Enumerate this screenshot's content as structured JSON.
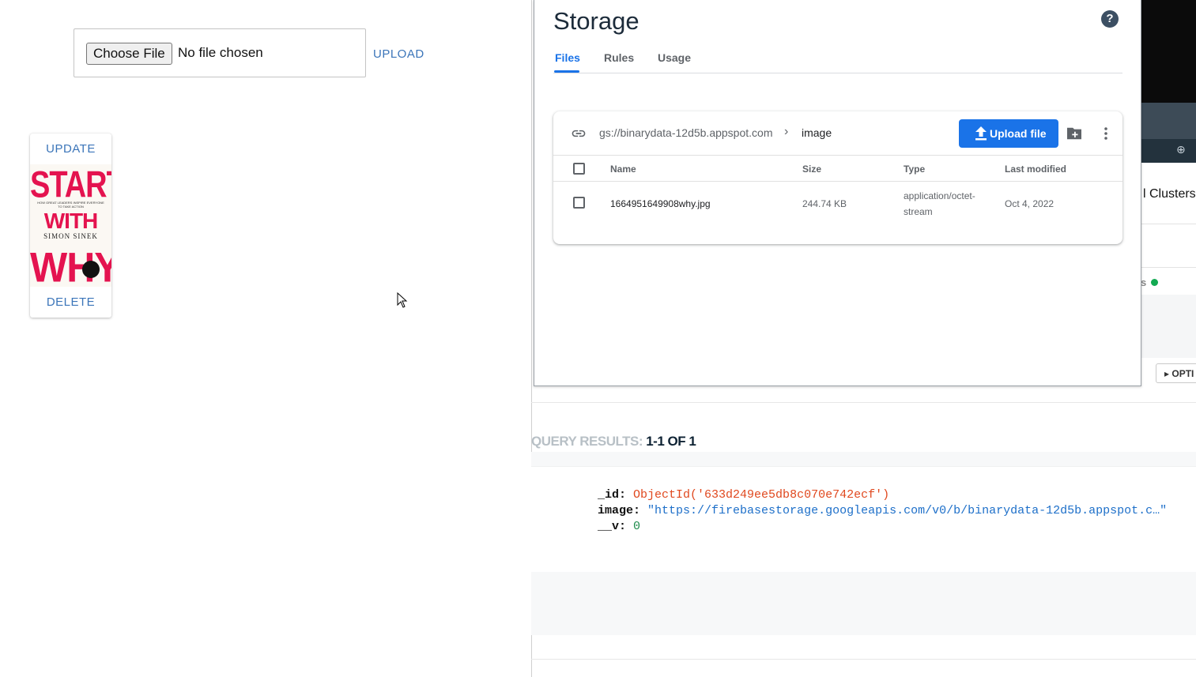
{
  "left_app": {
    "choose_file_label": "Choose File",
    "no_file_text": "No file chosen",
    "upload_label": "UPLOAD",
    "card": {
      "update_label": "UPDATE",
      "delete_label": "DELETE",
      "cover": {
        "line1": "START",
        "line2": "WITH",
        "line3": "WHY",
        "subtitle": "HOW GREAT LEADERS INSPIRE EVERYONE TO TAKE ACTION",
        "author": "SIMON SINEK"
      }
    }
  },
  "storage": {
    "title": "Storage",
    "help_icon": "help-icon",
    "tabs": [
      {
        "label": "Files",
        "active": true
      },
      {
        "label": "Rules",
        "active": false
      },
      {
        "label": "Usage",
        "active": false
      }
    ],
    "bucket_path": "gs://binarydata-12d5b.appspot.com",
    "folder": "image",
    "upload_file_label": "Upload file",
    "columns": [
      "Name",
      "Size",
      "Type",
      "Last modified"
    ],
    "rows": [
      {
        "name": "1664951649908why.jpg",
        "size": "244.74 KB",
        "type_line1": "application/octet-",
        "type_line2": "stream",
        "modified": "Oct 4, 2022"
      }
    ],
    "accent_color": "#1a73e8"
  },
  "mongo": {
    "clusters_label": "l Clusters",
    "status_fragment": "s",
    "options_label": "OPTI",
    "query_results_label": "QUERY RESULTS:",
    "query_results_value": "1-1 OF 1",
    "document": {
      "id_key": "_id:",
      "id_value": "ObjectId('633d249ee5db8c070e742ecf')",
      "image_key": "image:",
      "image_value": "\"https://firebasestorage.googleapis.com/v0/b/binarydata-12d5b.appspot.c…\"",
      "v_key": "__v:",
      "v_value": "0"
    }
  }
}
